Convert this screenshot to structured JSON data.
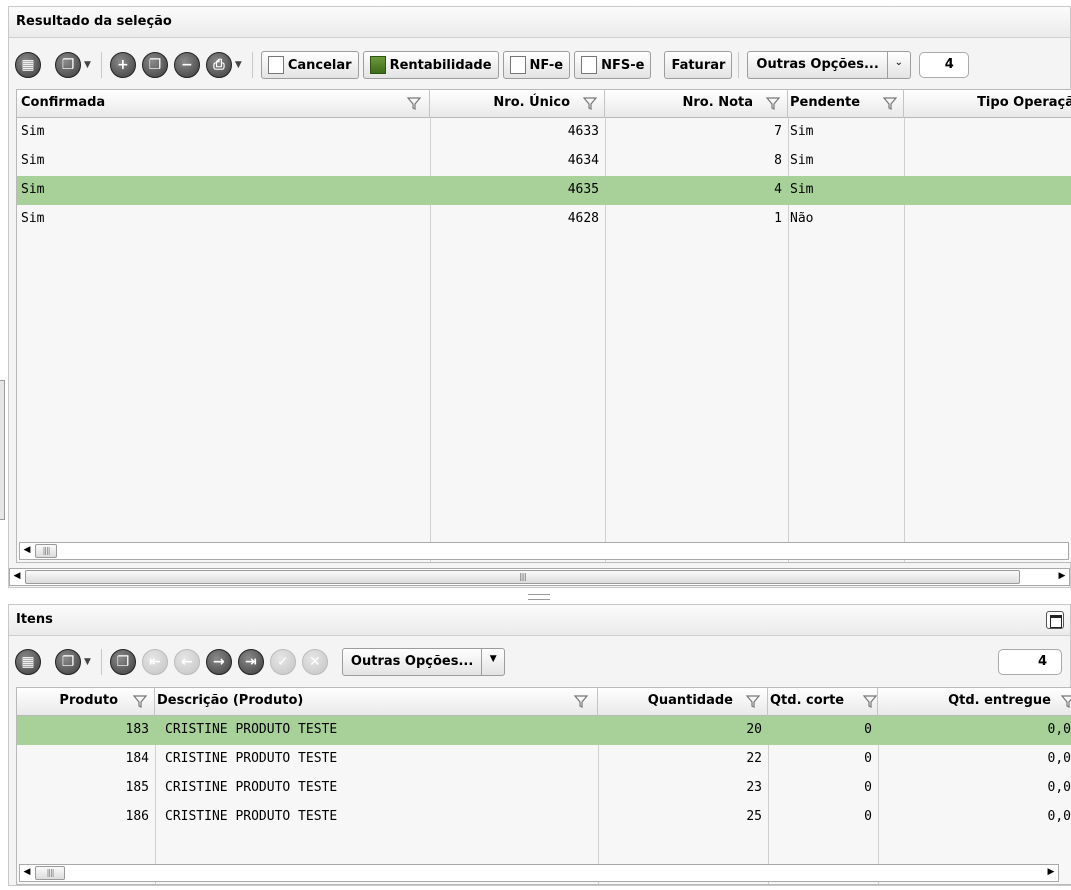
{
  "top_panel": {
    "title": "Resultado da seleção",
    "buttons": {
      "cancelar": "Cancelar",
      "rentabilidade": "Rentabilidade",
      "nfe": "NF-e",
      "nfse": "NFS-e",
      "faturar": "Faturar",
      "outras_opcoes": "Outras Opções...",
      "count": "4"
    },
    "columns": [
      "Confirmada",
      "Nro. Único",
      "Nro. Nota",
      "Pendente",
      "Tipo Operaçã"
    ],
    "rows": [
      {
        "confirmada": "Sim",
        "nro_unico": "4633",
        "nro_nota": "7",
        "pendente": "Sim",
        "tipo": ""
      },
      {
        "confirmada": "Sim",
        "nro_unico": "4634",
        "nro_nota": "8",
        "pendente": "Sim",
        "tipo": ""
      },
      {
        "confirmada": "Sim",
        "nro_unico": "4635",
        "nro_nota": "4",
        "pendente": "Sim",
        "tipo": ""
      },
      {
        "confirmada": "Sim",
        "nro_unico": "4628",
        "nro_nota": "1",
        "pendente": "Não",
        "tipo": ""
      }
    ],
    "selected_row": 2
  },
  "items_panel": {
    "title": "Itens",
    "outras_opcoes": "Outras Opções...",
    "count": "4",
    "columns": [
      "Produto",
      "Descrição (Produto)",
      "Quantidade",
      "Qtd. corte",
      "Qtd. entregue"
    ],
    "rows": [
      {
        "produto": "183",
        "descricao": "CRISTINE PRODUTO TESTE",
        "quantidade": "20",
        "qtd_corte": "0",
        "qtd_entregue": "0,0"
      },
      {
        "produto": "184",
        "descricao": "CRISTINE PRODUTO TESTE",
        "quantidade": "22",
        "qtd_corte": "0",
        "qtd_entregue": "0,0"
      },
      {
        "produto": "185",
        "descricao": "CRISTINE PRODUTO TESTE",
        "quantidade": "23",
        "qtd_corte": "0",
        "qtd_entregue": "0,0"
      },
      {
        "produto": "186",
        "descricao": "CRISTINE PRODUTO TESTE",
        "quantidade": "25",
        "qtd_corte": "0",
        "qtd_entregue": "0,0"
      }
    ],
    "selected_row": 0
  },
  "colors": {
    "selection": "#a8d19a",
    "panel_bg": "#f4f4f4"
  }
}
